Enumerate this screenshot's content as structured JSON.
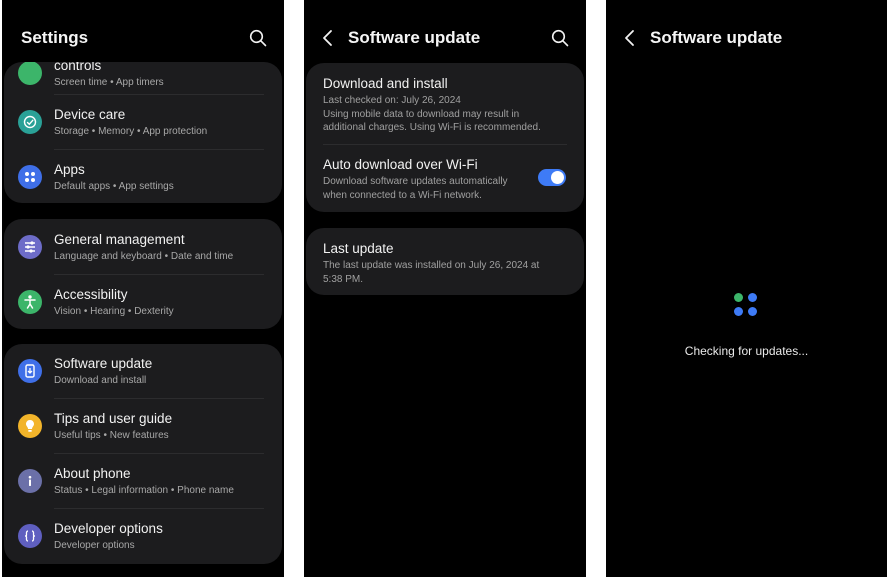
{
  "colors": {
    "accent": "#3e7bf6",
    "background": "#000000",
    "card": "#1c1c1e",
    "icon_green": "#3cb56a",
    "icon_teal": "#2aa197",
    "icon_blue": "#3f6fe8",
    "icon_slate": "#6d6cc8",
    "icon_yellow": "#f2b42a",
    "icon_gray": "#6b70a8",
    "icon_purple": "#5f5fc0"
  },
  "settings": {
    "title": "Settings",
    "search_icon": "search-icon",
    "partial_item": {
      "label": "controls",
      "sub": "Screen time  •  App timers"
    },
    "group1": [
      {
        "label": "Device care",
        "sub": "Storage  •  Memory  •  App protection",
        "icon": "device-care-icon"
      },
      {
        "label": "Apps",
        "sub": "Default apps  •  App settings",
        "icon": "apps-icon"
      }
    ],
    "group2": [
      {
        "label": "General management",
        "sub": "Language and keyboard  •  Date and time",
        "icon": "sliders-icon"
      },
      {
        "label": "Accessibility",
        "sub": "Vision  •  Hearing  •  Dexterity",
        "icon": "accessibility-icon"
      }
    ],
    "group3": [
      {
        "label": "Software update",
        "sub": "Download and install",
        "icon": "software-update-icon"
      },
      {
        "label": "Tips and user guide",
        "sub": "Useful tips  •  New features",
        "icon": "lightbulb-icon"
      },
      {
        "label": "About phone",
        "sub": "Status  •  Legal information  •  Phone name",
        "icon": "info-icon"
      },
      {
        "label": "Developer options",
        "sub": "Developer options",
        "icon": "braces-icon"
      }
    ]
  },
  "software_update": {
    "title": "Software update",
    "download": {
      "label": "Download and install",
      "line1": "Last checked on: July 26, 2024",
      "line2": "Using mobile data to download may result in",
      "line3": "additional charges. Using Wi-Fi is recommended."
    },
    "auto": {
      "label": "Auto download over Wi-Fi",
      "line1": "Download software updates automatically",
      "line2": "when connected to a Wi-Fi network.",
      "enabled": true
    },
    "last": {
      "label": "Last update",
      "line1": "The last update was installed on July 26, 2024 at",
      "line2": "5:38 PM."
    }
  },
  "checking": {
    "title": "Software update",
    "status": "Checking for updates..."
  }
}
